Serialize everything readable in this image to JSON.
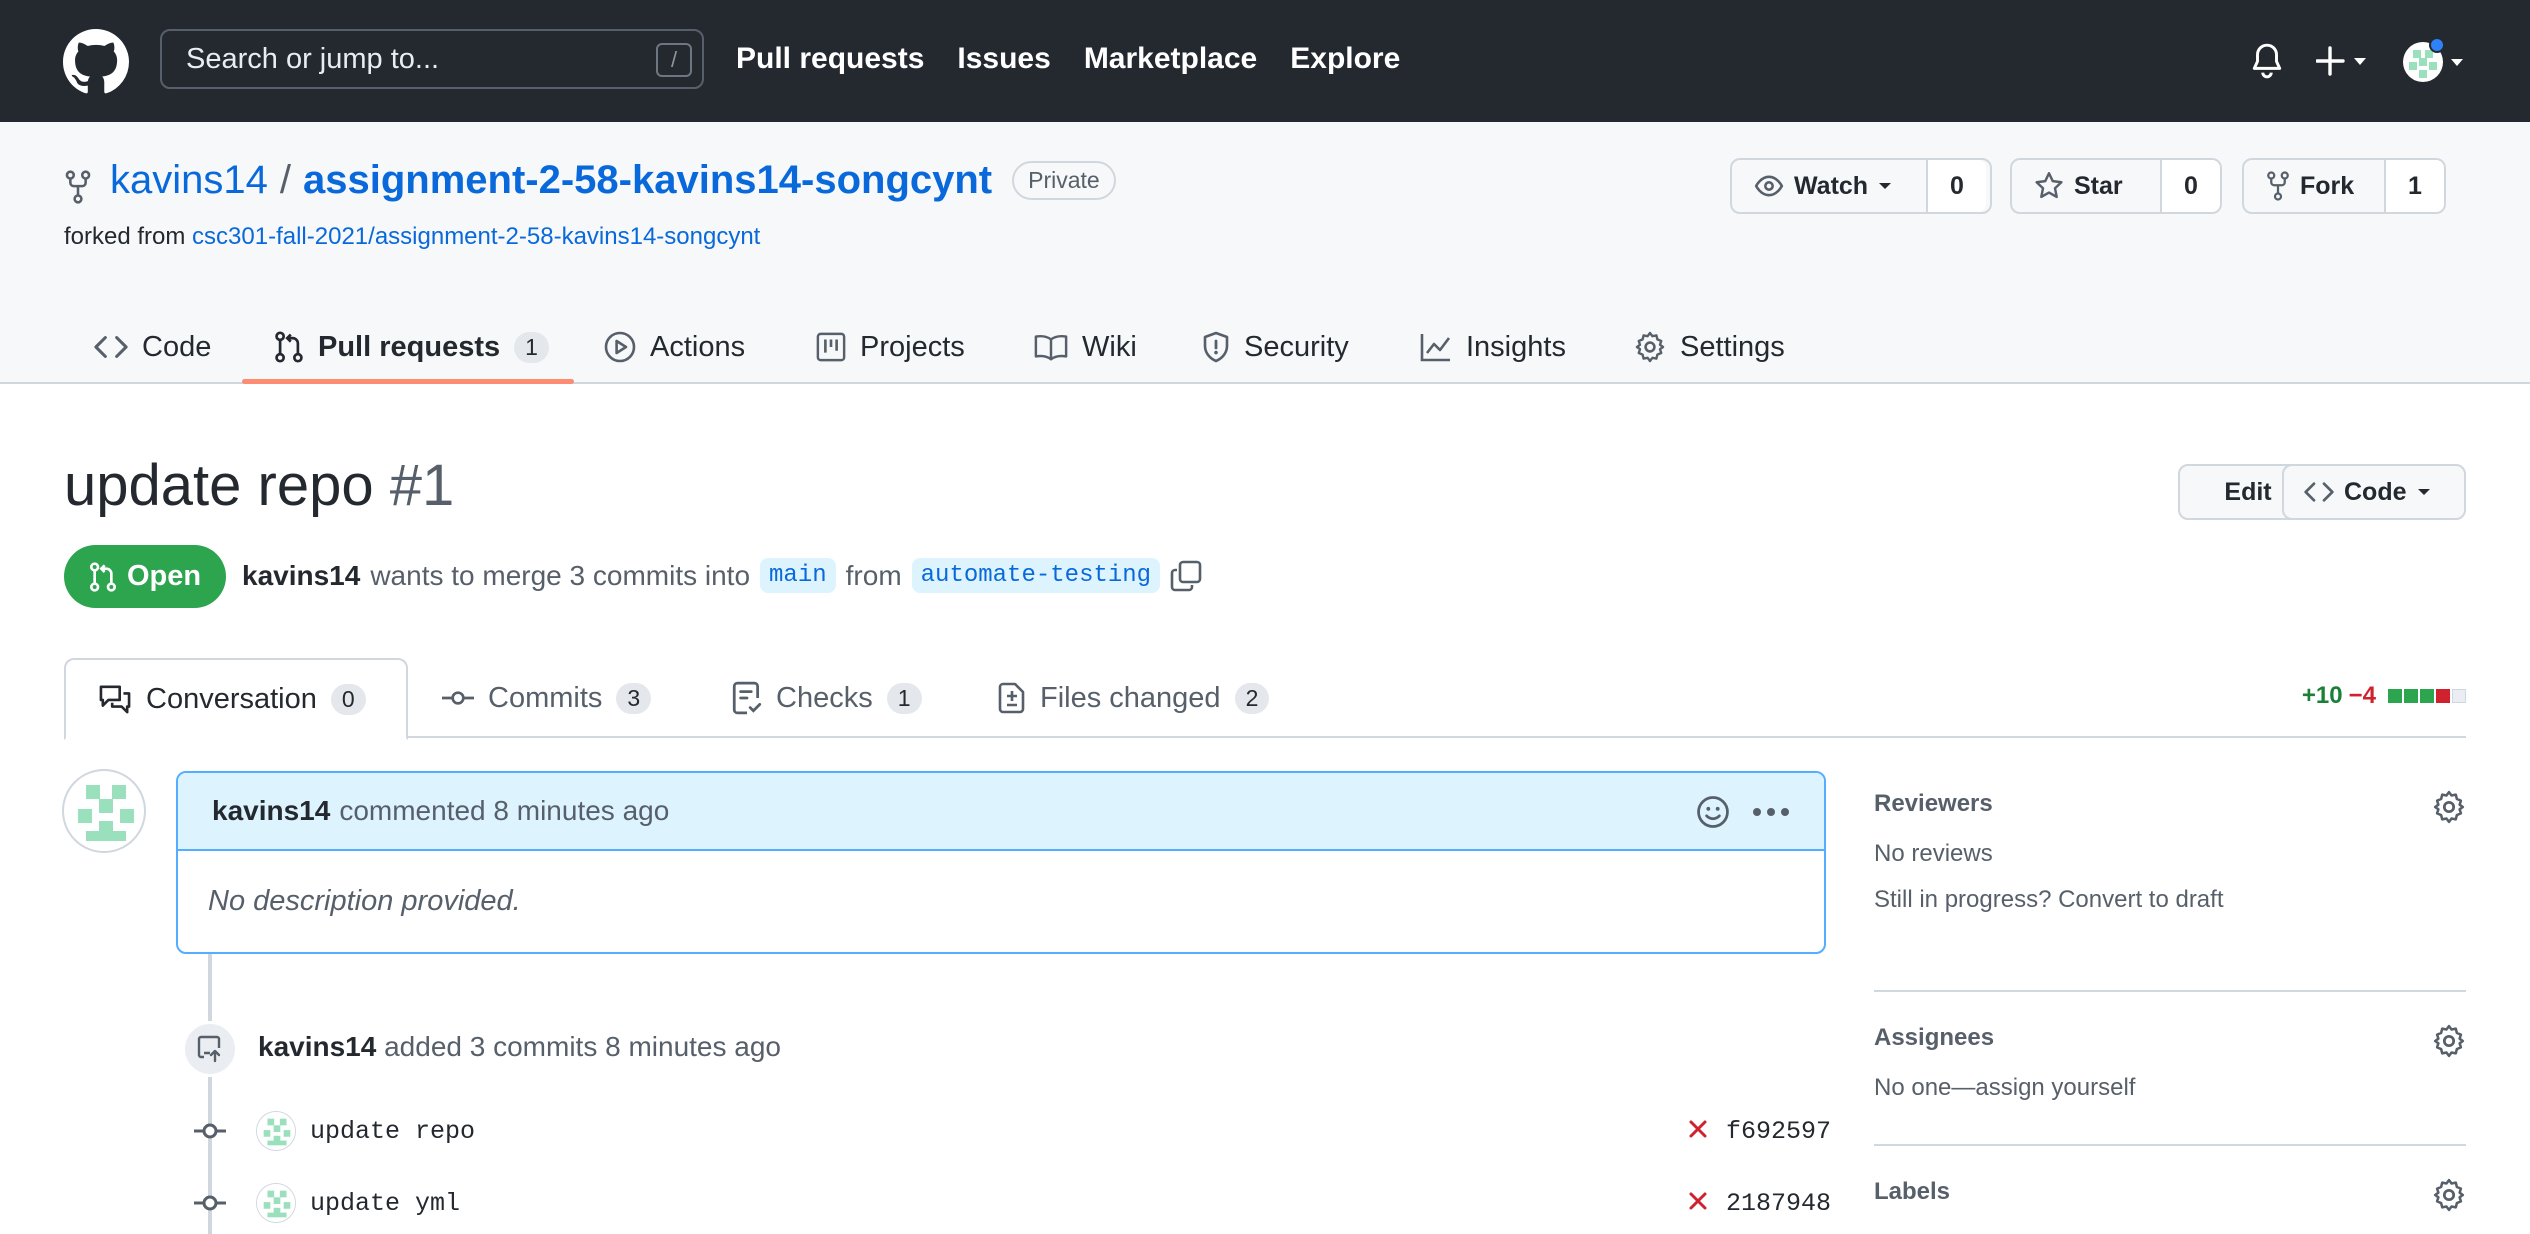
{
  "header": {
    "search_placeholder": "Search or jump to...",
    "search_shortcut": "/",
    "nav": [
      "Pull requests",
      "Issues",
      "Marketplace",
      "Explore"
    ]
  },
  "repo": {
    "owner": "kavins14",
    "separator": "/",
    "name": "assignment-2-58-kavins14-songcynt",
    "visibility": "Private",
    "forked_prefix": "forked from",
    "forked_from": "csc301-fall-2021/assignment-2-58-kavins14-songcynt",
    "watch": {
      "label": "Watch",
      "count": "0"
    },
    "star": {
      "label": "Star",
      "count": "0"
    },
    "fork": {
      "label": "Fork",
      "count": "1"
    }
  },
  "tabs": [
    {
      "label": "Code"
    },
    {
      "label": "Pull requests",
      "count": "1"
    },
    {
      "label": "Actions"
    },
    {
      "label": "Projects"
    },
    {
      "label": "Wiki"
    },
    {
      "label": "Security"
    },
    {
      "label": "Insights"
    },
    {
      "label": "Settings"
    }
  ],
  "pr": {
    "title": "update repo",
    "number": "#1",
    "edit_label": "Edit",
    "code_label": "Code",
    "state": "Open",
    "author": "kavins14",
    "merge_text": "wants to merge 3 commits into",
    "base": "main",
    "from_text": "from",
    "head": "automate-testing"
  },
  "pr_tabs": [
    {
      "label": "Conversation",
      "count": "0"
    },
    {
      "label": "Commits",
      "count": "3"
    },
    {
      "label": "Checks",
      "count": "1"
    },
    {
      "label": "Files changed",
      "count": "2"
    }
  ],
  "diffstat": {
    "additions": "+10",
    "deletions": "−4",
    "colors": [
      "#2da44e",
      "#2da44e",
      "#2da44e",
      "#cf222e",
      "#eaeef2"
    ]
  },
  "comment": {
    "author": "kavins14",
    "meta": "commented 8 minutes ago",
    "body": "No description provided."
  },
  "timeline": {
    "author": "kavins14",
    "event": "added 3 commits 8 minutes ago",
    "commits": [
      {
        "message": "update repo",
        "sha": "f692597"
      },
      {
        "message": "update yml",
        "sha": "2187948"
      }
    ]
  },
  "sidebar": {
    "reviewers_title": "Reviewers",
    "reviewers_value": "No reviews",
    "draft_text": "Still in progress? Convert to draft",
    "assignees_title": "Assignees",
    "assignees_value": "No one—assign yourself",
    "labels_title": "Labels"
  },
  "colors": {
    "header_bg": "#24292f",
    "link": "#0969da",
    "open_green": "#2da44e",
    "tab_underline": "#fd8c73"
  }
}
